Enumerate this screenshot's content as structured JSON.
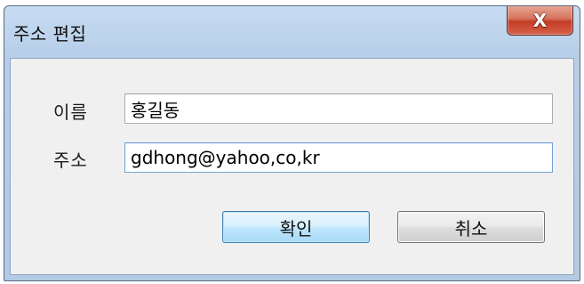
{
  "window": {
    "title": "주소 편집",
    "close_glyph": "X",
    "close_icon": "close-icon"
  },
  "form": {
    "name_label": "이름",
    "name_value": "홍길동",
    "address_label": "주소",
    "address_value": "gdhong@yahoo,co,kr"
  },
  "buttons": {
    "ok_label": "확인",
    "cancel_label": "취소"
  },
  "colors": {
    "title_bar": "#b9cfe8",
    "close_button": "#c43d25",
    "ok_button_border": "#3c7fb1",
    "dialog_background": "#f0f0f0"
  }
}
